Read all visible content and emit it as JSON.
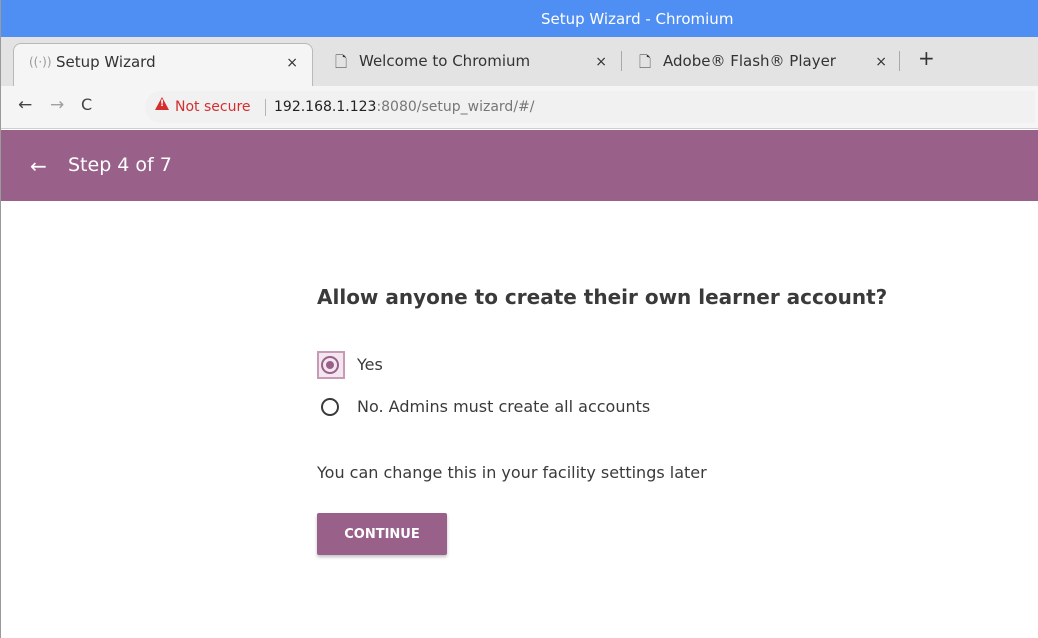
{
  "window": {
    "title": "Setup Wizard - Chromium"
  },
  "tabs": [
    {
      "label": "Setup Wizard",
      "icon": "broadcast-icon",
      "active": true
    },
    {
      "label": "Welcome to Chromium",
      "icon": "document-icon",
      "active": false
    },
    {
      "label": "Adobe® Flash® Player",
      "icon": "document-icon",
      "active": false
    }
  ],
  "tab_close_glyph": "×",
  "new_tab_glyph": "+",
  "toolbar": {
    "back_glyph": "←",
    "forward_glyph": "→",
    "reload_glyph": "C",
    "security_label": "Not secure",
    "url_host": "192.168.1.123",
    "url_rest": ":8080/setup_wizard/#/"
  },
  "appbar": {
    "back_glyph": "←",
    "step_text": "Step 4 of 7",
    "color": "#996189"
  },
  "main": {
    "question": "Allow anyone to create their own learner account?",
    "options": [
      {
        "label": "Yes",
        "selected": true
      },
      {
        "label": "No. Admins must create all accounts",
        "selected": false
      }
    ],
    "hint": "You can change this in your facility settings later",
    "continue_label": "CONTINUE"
  },
  "colors": {
    "titlebar": "#4f8ef3",
    "accent": "#996189",
    "warning": "#d32f2f"
  }
}
